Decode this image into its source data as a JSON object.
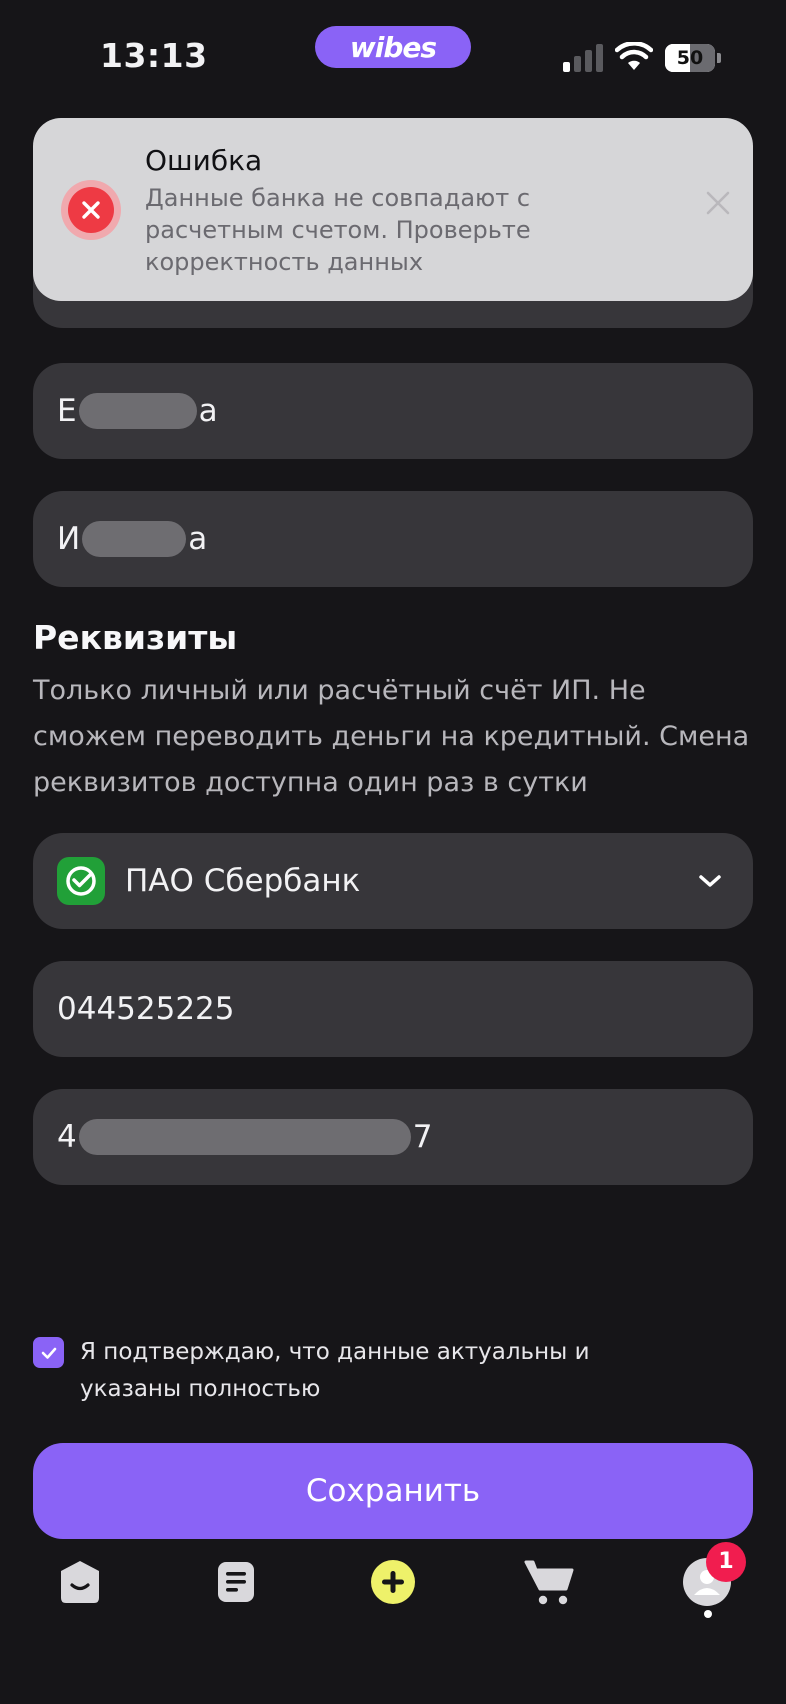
{
  "status_bar": {
    "time": "13:13",
    "app_pill": "wibes",
    "battery_level": "50",
    "icons": [
      "signal-icon",
      "wifi-icon",
      "battery-icon"
    ]
  },
  "toast": {
    "title": "Ошибка",
    "message": "Данные банка не совпадают с расчетным счетом. Проверьте корректность данных",
    "icon": "error-icon",
    "close_icon": "close-icon"
  },
  "form": {
    "surname": {
      "prefix": "Е",
      "suffix": "а"
    },
    "name": {
      "prefix": "И",
      "suffix": "а"
    }
  },
  "requisites": {
    "title": "Реквизиты",
    "description": "Только личный или расчётный счёт ИП. Не сможем переводить деньги на кредитный. Смена реквизитов доступна один раз в сутки",
    "bank": {
      "name": "ПАО Сбербанк",
      "logo": "sberbank-logo-icon"
    },
    "bik": "044525225",
    "account": {
      "prefix": "4",
      "suffix": "7"
    }
  },
  "consent": {
    "checked": true,
    "text": "Я подтверждаю, что данные актуальны и указаны полностью"
  },
  "save_label": "Сохранить",
  "tab_bar": {
    "items": [
      "home-icon",
      "orders-icon",
      "add-icon",
      "cart-icon",
      "profile-icon"
    ],
    "profile_badge": "1",
    "active": "profile"
  },
  "colors": {
    "background": "#161518",
    "field": "#37363a",
    "accent": "#8a63f6",
    "error": "#ee3a44",
    "badge": "#f11d4f",
    "add_button": "#eef16a"
  }
}
